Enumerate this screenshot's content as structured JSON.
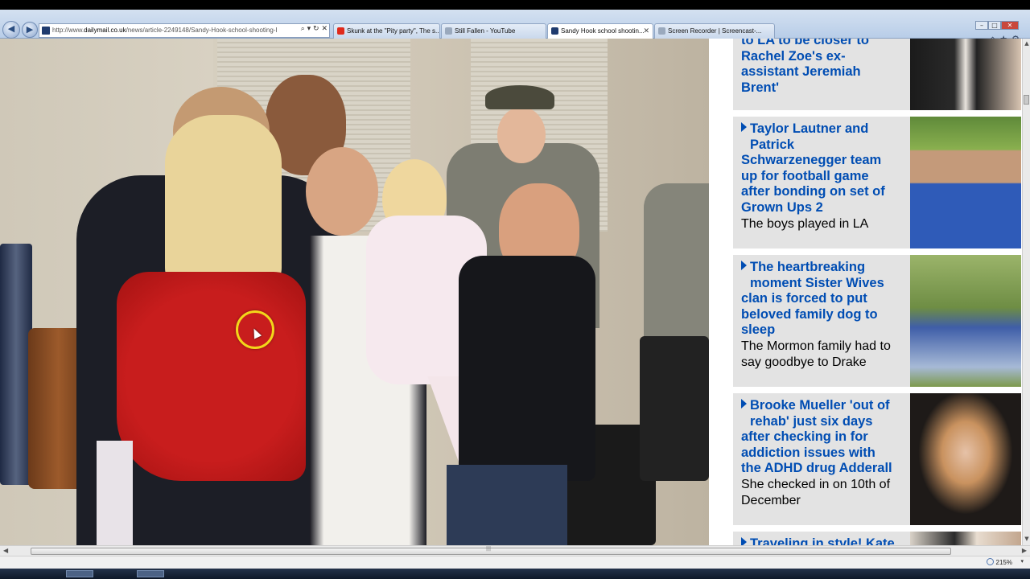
{
  "browser": {
    "address": {
      "url_prefix": "http://www.",
      "url_host": "dailymail.co.uk",
      "url_path": "/news/article-2249148/Sandy-Hook-school-shooting-I",
      "controls": "⌕ ▾ ↻ ✕"
    },
    "tabs": [
      {
        "label": "Skunk at the \"Pity party\", The s...",
        "icon_color": "#e02a1b",
        "active": false
      },
      {
        "label": "Still Fallen - YouTube",
        "icon_color": "#9aa9bd",
        "active": false
      },
      {
        "label": "Sandy Hook school shootin...",
        "icon_color": "#1f3b6e",
        "active": true
      },
      {
        "label": "Screen Recorder | Screencast-...",
        "icon_color": "#9aa9bd",
        "active": false
      }
    ],
    "window_controls": {
      "minimize": "–",
      "maximize": "□",
      "close": "✕"
    },
    "toolbar_icons": [
      "home-icon",
      "star-icon",
      "gear-icon"
    ],
    "toolbar_glyphs": "⌂★⚙",
    "zoom_level": "215%",
    "zoom_dropdown": "▾"
  },
  "sidebar": {
    "items": [
      {
        "headline_lines": [
          "to LA to be closer to",
          "Rachel Zoe's ex-",
          "assistant Jeremiah",
          "Brent'"
        ],
        "subtitle_lines": [],
        "thumb": "couple-photo"
      },
      {
        "headline_lines": [
          "Taylor Lautner and",
          "Patrick",
          "Schwarzenegger team",
          "up for football game",
          "after bonding on set of",
          "Grown Ups 2"
        ],
        "subtitle_lines": [
          "The boys played in LA"
        ],
        "thumb": "man-ucla-shirt-photo"
      },
      {
        "headline_lines": [
          "The heartbreaking",
          "moment Sister Wives",
          "clan is forced to put",
          "beloved family dog to",
          "sleep"
        ],
        "subtitle_lines": [
          "The Mormon family had to",
          "say goodbye to Drake"
        ],
        "thumb": "boy-with-dog-photo"
      },
      {
        "headline_lines": [
          "Brooke Mueller 'out of",
          "rehab' just six days",
          "after checking in for",
          "addiction issues with",
          "the ADHD drug Adderall"
        ],
        "subtitle_lines": [
          "She checked in on 10th of",
          "December"
        ],
        "thumb": "woman-headband-photo"
      },
      {
        "headline_lines": [
          "Traveling in style! Kate"
        ],
        "subtitle_lines": [],
        "thumb": "travel-photo"
      }
    ]
  },
  "colors": {
    "headline": "#004db3",
    "card_bg": "#e3e3e3",
    "cursor_ring": "#f3d61a",
    "dress_red": "#c81d1d"
  }
}
